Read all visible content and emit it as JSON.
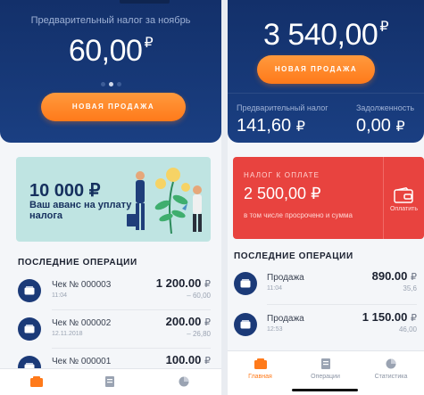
{
  "left": {
    "hero": {
      "caption": "Предварительный налог за ноябрь",
      "amount": "60,00",
      "currency": "₽",
      "pager": {
        "count": 3,
        "active": 1
      },
      "cta_label": "НОВАЯ ПРОДАЖА"
    },
    "promo": {
      "amount": "10 000 ₽",
      "text": "Ваш аванс на уплату налога"
    },
    "operations_title": "ПОСЛЕДНИЕ ОПЕРАЦИИ",
    "operations": [
      {
        "title": "Чек № 000003",
        "sub": "11:04",
        "amount": "1 200.00",
        "currency": "₽",
        "tax": "– 60,00"
      },
      {
        "title": "Чек № 000002",
        "sub": "12.11.2018",
        "amount": "200.00",
        "currency": "₽",
        "tax": "– 26,80"
      },
      {
        "title": "Чек № 000001",
        "sub": "",
        "amount": "100.00",
        "currency": "₽",
        "tax": ""
      }
    ],
    "tabbar": {
      "active_index": 0
    }
  },
  "right": {
    "hero": {
      "amount": "3 540,00",
      "currency": "₽",
      "cta_label": "НОВАЯ ПРОДАЖА",
      "stats": [
        {
          "label": "Предварительный налог",
          "value": "141,60",
          "currency": "₽"
        },
        {
          "label": "Задолженность",
          "value": "0,00",
          "currency": "₽"
        }
      ]
    },
    "tax_card": {
      "title": "НАЛОГ К ОПЛАТЕ",
      "amount": "2 500,00 ₽",
      "note": "в том числе просрочено и сумма",
      "pay_label": "Оплатить",
      "pay_icon": "wallet-icon"
    },
    "operations_title": "ПОСЛЕДНИЕ ОПЕРАЦИИ",
    "operations": [
      {
        "title": "Продажа",
        "sub": "11:04",
        "amount": "890.00",
        "currency": "₽",
        "tax": "35,6"
      },
      {
        "title": "Продажа",
        "sub": "12:53",
        "amount": "1 150.00",
        "currency": "₽",
        "tax": "46,00"
      }
    ],
    "tabbar": {
      "active_index": 0,
      "tabs": [
        {
          "label": "Главная",
          "icon": "home-icon"
        },
        {
          "label": "Операции",
          "icon": "receipt-icon"
        },
        {
          "label": "Статистика",
          "icon": "pie-chart-icon"
        }
      ]
    }
  },
  "colors": {
    "navy": "#13306a",
    "accent_orange": "#ff7a1a",
    "tax_red": "#e8433f",
    "promo_teal": "#bfe4e2"
  }
}
